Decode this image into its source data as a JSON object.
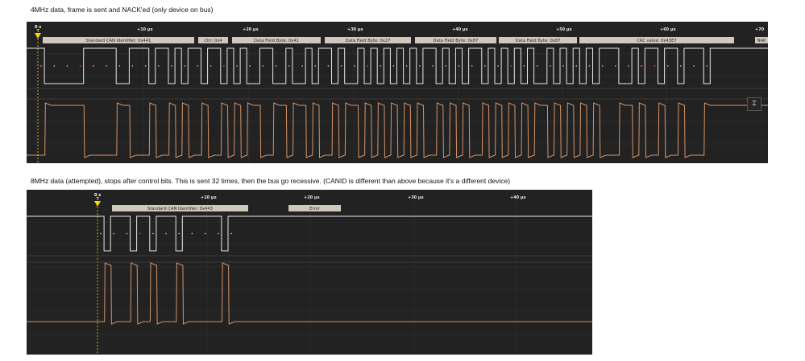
{
  "captions": {
    "top": "4MHz data, frame is sent and NACK'ed (only device on bus)",
    "bottom": "8MHz data (attempted), stops after control bits. This is sent 32 times, then the bus go recessive. (CANID is different than above because it's a different device)"
  },
  "colors": {
    "background": "#222222",
    "digital_trace": "#e8e8e8",
    "analog_trace": "#e09a6a",
    "annotation_box": "#cfc9bc",
    "trigger": "#ffd700",
    "sample_dot": "#e8a070",
    "error_dot": "#e53935"
  },
  "scopes": [
    {
      "id": "top",
      "zero_label": "0 s",
      "trigger_label": "T",
      "time_ticks": [
        "+10 µs",
        "+20 µs",
        "+30 µs",
        "+40 µs",
        "+50 µs",
        "+60 µs",
        "+70"
      ],
      "annotations": [
        {
          "label": "Standard CAN Identifier: 0x441"
        },
        {
          "label": "Ctrl: 0x4"
        },
        {
          "label": "Data Field Byte: 0x41"
        },
        {
          "label": "Data Field Byte: 0x27"
        },
        {
          "label": "Data Field Byte: 0x87"
        },
        {
          "label": "Data Field Byte: 0x87"
        },
        {
          "label": "CRC value: 0x43E7"
        },
        {
          "label": "NAK"
        }
      ],
      "cursor_button_icon": "⌶"
    },
    {
      "id": "bottom",
      "zero_label": "0 s",
      "trigger_label": "T",
      "time_ticks": [
        "+10 µs",
        "+20 µs",
        "+30 µs",
        "+40 µs"
      ],
      "annotations": [
        {
          "label": "Standard CAN Identifier: 0x443"
        },
        {
          "label": "Error"
        }
      ]
    }
  ]
}
